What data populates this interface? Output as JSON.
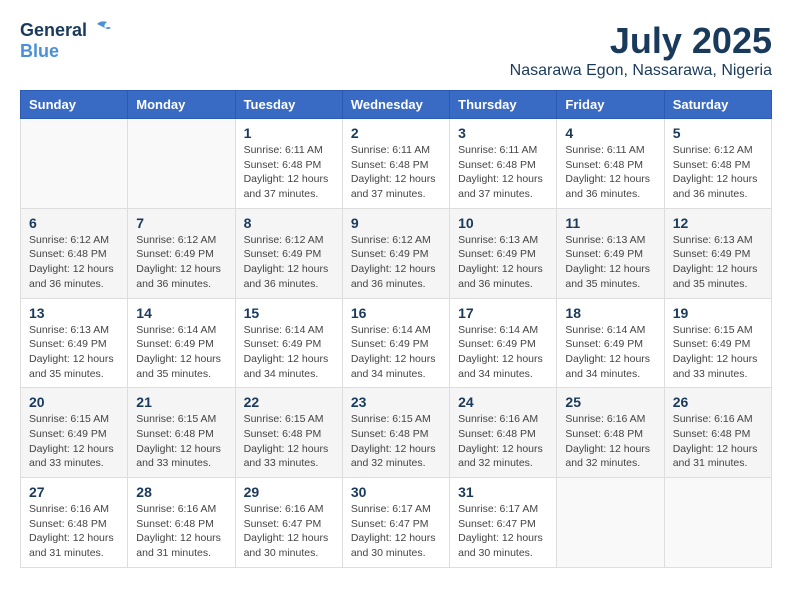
{
  "header": {
    "logo_general": "General",
    "logo_blue": "Blue",
    "month_year": "July 2025",
    "location": "Nasarawa Egon, Nassarawa, Nigeria"
  },
  "weekdays": [
    "Sunday",
    "Monday",
    "Tuesday",
    "Wednesday",
    "Thursday",
    "Friday",
    "Saturday"
  ],
  "weeks": [
    [
      {
        "day": "",
        "info": ""
      },
      {
        "day": "",
        "info": ""
      },
      {
        "day": "1",
        "info": "Sunrise: 6:11 AM\nSunset: 6:48 PM\nDaylight: 12 hours and 37 minutes."
      },
      {
        "day": "2",
        "info": "Sunrise: 6:11 AM\nSunset: 6:48 PM\nDaylight: 12 hours and 37 minutes."
      },
      {
        "day": "3",
        "info": "Sunrise: 6:11 AM\nSunset: 6:48 PM\nDaylight: 12 hours and 37 minutes."
      },
      {
        "day": "4",
        "info": "Sunrise: 6:11 AM\nSunset: 6:48 PM\nDaylight: 12 hours and 36 minutes."
      },
      {
        "day": "5",
        "info": "Sunrise: 6:12 AM\nSunset: 6:48 PM\nDaylight: 12 hours and 36 minutes."
      }
    ],
    [
      {
        "day": "6",
        "info": "Sunrise: 6:12 AM\nSunset: 6:48 PM\nDaylight: 12 hours and 36 minutes."
      },
      {
        "day": "7",
        "info": "Sunrise: 6:12 AM\nSunset: 6:49 PM\nDaylight: 12 hours and 36 minutes."
      },
      {
        "day": "8",
        "info": "Sunrise: 6:12 AM\nSunset: 6:49 PM\nDaylight: 12 hours and 36 minutes."
      },
      {
        "day": "9",
        "info": "Sunrise: 6:12 AM\nSunset: 6:49 PM\nDaylight: 12 hours and 36 minutes."
      },
      {
        "day": "10",
        "info": "Sunrise: 6:13 AM\nSunset: 6:49 PM\nDaylight: 12 hours and 36 minutes."
      },
      {
        "day": "11",
        "info": "Sunrise: 6:13 AM\nSunset: 6:49 PM\nDaylight: 12 hours and 35 minutes."
      },
      {
        "day": "12",
        "info": "Sunrise: 6:13 AM\nSunset: 6:49 PM\nDaylight: 12 hours and 35 minutes."
      }
    ],
    [
      {
        "day": "13",
        "info": "Sunrise: 6:13 AM\nSunset: 6:49 PM\nDaylight: 12 hours and 35 minutes."
      },
      {
        "day": "14",
        "info": "Sunrise: 6:14 AM\nSunset: 6:49 PM\nDaylight: 12 hours and 35 minutes."
      },
      {
        "day": "15",
        "info": "Sunrise: 6:14 AM\nSunset: 6:49 PM\nDaylight: 12 hours and 34 minutes."
      },
      {
        "day": "16",
        "info": "Sunrise: 6:14 AM\nSunset: 6:49 PM\nDaylight: 12 hours and 34 minutes."
      },
      {
        "day": "17",
        "info": "Sunrise: 6:14 AM\nSunset: 6:49 PM\nDaylight: 12 hours and 34 minutes."
      },
      {
        "day": "18",
        "info": "Sunrise: 6:14 AM\nSunset: 6:49 PM\nDaylight: 12 hours and 34 minutes."
      },
      {
        "day": "19",
        "info": "Sunrise: 6:15 AM\nSunset: 6:49 PM\nDaylight: 12 hours and 33 minutes."
      }
    ],
    [
      {
        "day": "20",
        "info": "Sunrise: 6:15 AM\nSunset: 6:49 PM\nDaylight: 12 hours and 33 minutes."
      },
      {
        "day": "21",
        "info": "Sunrise: 6:15 AM\nSunset: 6:48 PM\nDaylight: 12 hours and 33 minutes."
      },
      {
        "day": "22",
        "info": "Sunrise: 6:15 AM\nSunset: 6:48 PM\nDaylight: 12 hours and 33 minutes."
      },
      {
        "day": "23",
        "info": "Sunrise: 6:15 AM\nSunset: 6:48 PM\nDaylight: 12 hours and 32 minutes."
      },
      {
        "day": "24",
        "info": "Sunrise: 6:16 AM\nSunset: 6:48 PM\nDaylight: 12 hours and 32 minutes."
      },
      {
        "day": "25",
        "info": "Sunrise: 6:16 AM\nSunset: 6:48 PM\nDaylight: 12 hours and 32 minutes."
      },
      {
        "day": "26",
        "info": "Sunrise: 6:16 AM\nSunset: 6:48 PM\nDaylight: 12 hours and 31 minutes."
      }
    ],
    [
      {
        "day": "27",
        "info": "Sunrise: 6:16 AM\nSunset: 6:48 PM\nDaylight: 12 hours and 31 minutes."
      },
      {
        "day": "28",
        "info": "Sunrise: 6:16 AM\nSunset: 6:48 PM\nDaylight: 12 hours and 31 minutes."
      },
      {
        "day": "29",
        "info": "Sunrise: 6:16 AM\nSunset: 6:47 PM\nDaylight: 12 hours and 30 minutes."
      },
      {
        "day": "30",
        "info": "Sunrise: 6:17 AM\nSunset: 6:47 PM\nDaylight: 12 hours and 30 minutes."
      },
      {
        "day": "31",
        "info": "Sunrise: 6:17 AM\nSunset: 6:47 PM\nDaylight: 12 hours and 30 minutes."
      },
      {
        "day": "",
        "info": ""
      },
      {
        "day": "",
        "info": ""
      }
    ]
  ]
}
